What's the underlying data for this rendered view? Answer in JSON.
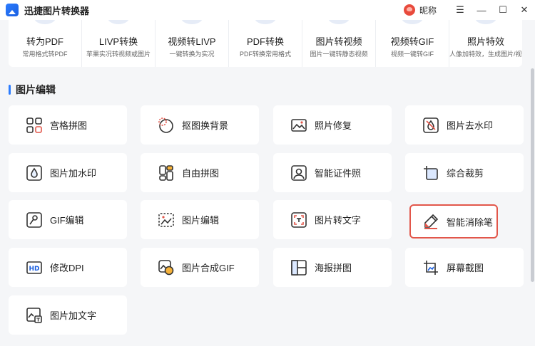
{
  "app": {
    "title": "迅捷图片转换器",
    "nickname": "昵称"
  },
  "window_controls": {
    "menu": "☰",
    "minimize": "—",
    "maximize": "☐",
    "close": "✕"
  },
  "top_features": [
    {
      "title": "转为PDF",
      "subtitle": "常用格式转PDF"
    },
    {
      "title": "LIVP转换",
      "subtitle": "苹果实况转视频或图片"
    },
    {
      "title": "视频转LIVP",
      "subtitle": "一键转换为实况"
    },
    {
      "title": "PDF转换",
      "subtitle": "PDF转换常用格式"
    },
    {
      "title": "图片转视频",
      "subtitle": "图片一键转静态视频"
    },
    {
      "title": "视频转GIF",
      "subtitle": "视频一键转GIF"
    },
    {
      "title": "照片特效",
      "subtitle": "人像加特效，生成图片/视频"
    }
  ],
  "section": {
    "title": "图片编辑"
  },
  "tools": [
    {
      "label": "宫格拼图",
      "icon": "grid-icon"
    },
    {
      "label": "抠图换背景",
      "icon": "cutout-icon"
    },
    {
      "label": "照片修复",
      "icon": "photo-repair-icon"
    },
    {
      "label": "图片去水印",
      "icon": "remove-watermark-icon"
    },
    {
      "label": "图片加水印",
      "icon": "add-watermark-icon"
    },
    {
      "label": "自由拼图",
      "icon": "free-collage-icon"
    },
    {
      "label": "智能证件照",
      "icon": "id-photo-icon"
    },
    {
      "label": "综合裁剪",
      "icon": "crop-icon"
    },
    {
      "label": "GIF编辑",
      "icon": "gif-edit-icon"
    },
    {
      "label": "图片编辑",
      "icon": "image-edit-icon"
    },
    {
      "label": "图片转文字",
      "icon": "ocr-icon"
    },
    {
      "label": "智能消除笔",
      "icon": "eraser-pen-icon",
      "selected": true
    },
    {
      "label": "修改DPI",
      "icon": "hd-icon"
    },
    {
      "label": "图片合成GIF",
      "icon": "make-gif-icon"
    },
    {
      "label": "海报拼图",
      "icon": "poster-icon"
    },
    {
      "label": "屏幕截图",
      "icon": "screenshot-icon"
    },
    {
      "label": "图片加文字",
      "icon": "add-text-icon"
    }
  ],
  "colors": {
    "accent": "#2b7cff",
    "highlight": "#e2564a",
    "icon_accent": "#e2564a"
  }
}
